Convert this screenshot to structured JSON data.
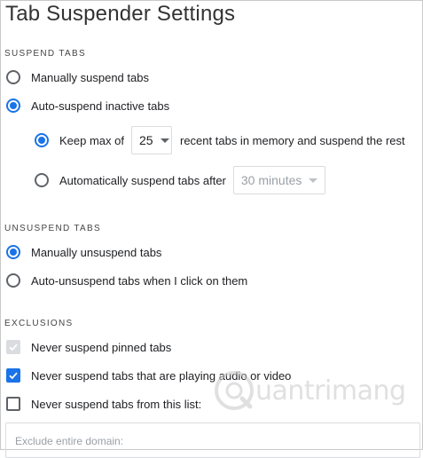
{
  "title": "Tab Suspender Settings",
  "suspend": {
    "heading": "SUSPEND TABS",
    "manual": "Manually suspend tabs",
    "auto": "Auto-suspend inactive tabs",
    "keep_max_prefix": "Keep max of",
    "keep_max_value": "25",
    "keep_max_suffix": "recent tabs in memory and suspend the rest",
    "auto_after": "Automatically suspend tabs after",
    "auto_after_value": "30 minutes"
  },
  "unsuspend": {
    "heading": "UNSUSPEND TABS",
    "manual": "Manually unsuspend tabs",
    "auto": "Auto-unsuspend tabs when I click on them"
  },
  "exclusions": {
    "heading": "EXCLUSIONS",
    "pinned": "Never suspend pinned tabs",
    "audio": "Never suspend tabs that are playing audio or video",
    "list": "Never suspend tabs from this list:",
    "placeholder": "Exclude entire domain:"
  },
  "watermark": {
    "text": "uantrimang",
    "icon": "watermark-logo-icon"
  },
  "colors": {
    "accent": "#1a73e8",
    "text": "#202124",
    "border": "#dadce0"
  },
  "icons": [
    "checkmark-icon",
    "chevron-down-icon"
  ]
}
